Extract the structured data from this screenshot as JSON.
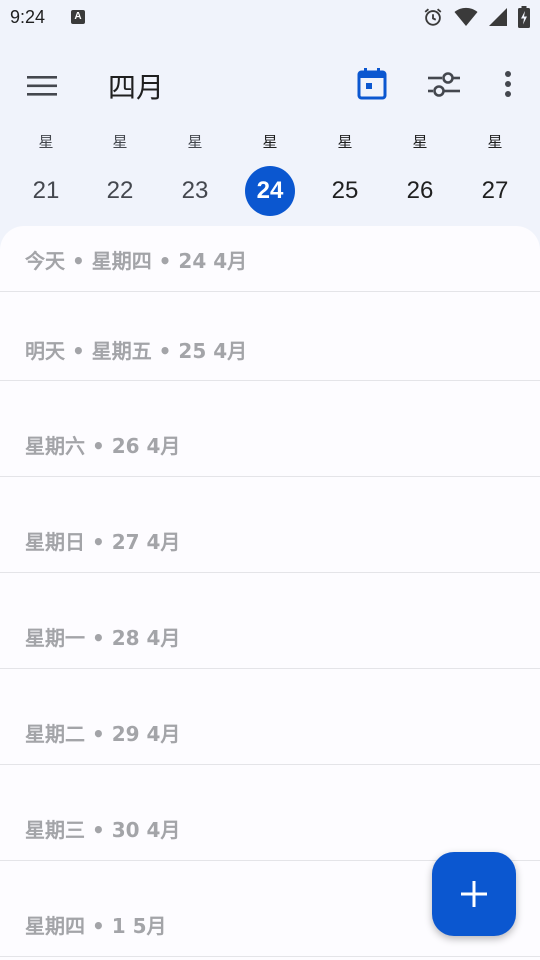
{
  "status_bar": {
    "time": "9:24",
    "app_icon_letter": "A",
    "icons": [
      "alarm-icon",
      "wifi-icon",
      "signal-icon",
      "battery-charging-icon"
    ]
  },
  "app_bar": {
    "title": "四月",
    "icons": {
      "menu": "menu-icon",
      "today": "calendar-today-icon",
      "filter": "tune-icon",
      "more": "more-vert-icon"
    }
  },
  "week": {
    "days": [
      {
        "label": "星",
        "number": "21",
        "state": "past"
      },
      {
        "label": "星",
        "number": "22",
        "state": "past"
      },
      {
        "label": "星",
        "number": "23",
        "state": "past"
      },
      {
        "label": "星",
        "number": "24",
        "state": "selected"
      },
      {
        "label": "星",
        "number": "25",
        "state": "future"
      },
      {
        "label": "星",
        "number": "26",
        "state": "future"
      },
      {
        "label": "星",
        "number": "27",
        "state": "future"
      }
    ]
  },
  "agenda": {
    "items": [
      {
        "label": "今天 • 星期四 • 24 4月"
      },
      {
        "label": "明天 • 星期五 • 25 4月"
      },
      {
        "label": "星期六 • 26 4月"
      },
      {
        "label": "星期日 • 27 4月"
      },
      {
        "label": "星期一 • 28 4月"
      },
      {
        "label": "星期二 • 29 4月"
      },
      {
        "label": "星期三 • 30 4月"
      },
      {
        "label": "星期四 • 1 5月"
      }
    ]
  },
  "fab": {
    "icon": "add-icon"
  },
  "colors": {
    "accent": "#0b57d0",
    "background": "#f0f3fb",
    "sheet": "#fdfcff",
    "muted_text": "#a3a4a8"
  }
}
